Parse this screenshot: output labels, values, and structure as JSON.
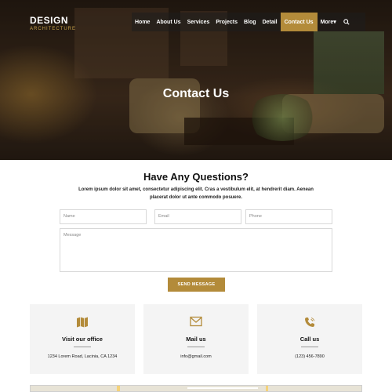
{
  "logo": {
    "line1": "DESIGN",
    "line2": "ARCHITECTURE"
  },
  "nav": {
    "items": [
      "Home",
      "About Us",
      "Services",
      "Projects",
      "Blog",
      "Detail",
      "Contact Us",
      "More▾"
    ],
    "active": "Contact Us",
    "search_icon": "search-icon"
  },
  "hero": {
    "title": "Contact Us"
  },
  "questions": {
    "title": "Have Any Questions?",
    "description": "Lorem ipsum dolor sit amet, consectetur adipiscing elit. Cras a vestibulum elit, at hendrerit diam. Aenean placerat dolor ut ante commodo posuere."
  },
  "form": {
    "name_placeholder": "Name",
    "email_placeholder": "Email",
    "phone_placeholder": "Phone",
    "message_placeholder": "Message",
    "submit_label": "SEND MESSAGE"
  },
  "cards": [
    {
      "icon": "map-icon",
      "title": "Visit our office",
      "value": "1234 Lorem Road, Lacinia, CA 1234"
    },
    {
      "icon": "mail-icon",
      "title": "Mail us",
      "value": "info@gmail.com"
    },
    {
      "icon": "phone-icon",
      "title": "Call us",
      "value": "(123) 456-7890"
    }
  ],
  "colors": {
    "accent": "#b38b3a",
    "card_bg": "#f4f4f4"
  }
}
